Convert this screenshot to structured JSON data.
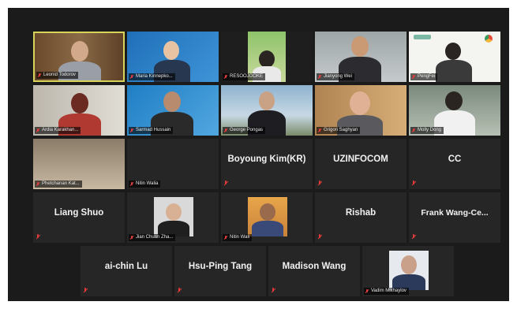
{
  "meeting": {
    "participants": [
      {
        "name": "Leonid Todorov",
        "style": "video",
        "active": true
      },
      {
        "name": "Maria Kinnepko...",
        "style": "video"
      },
      {
        "name": "RESOOJOOKE",
        "style": "video"
      },
      {
        "name": "Jianyong Wei",
        "style": "video"
      },
      {
        "name": "PengFei",
        "style": "video"
      },
      {
        "name": "Ardia Karakhan...",
        "style": "video"
      },
      {
        "name": "Sarmad Hussain",
        "style": "video"
      },
      {
        "name": "George Pongas",
        "style": "video"
      },
      {
        "name": "Grigori Saghyan",
        "style": "video"
      },
      {
        "name": "Molly Dong",
        "style": "video"
      },
      {
        "name": "Phetchanan Kat...",
        "style": "video"
      },
      {
        "name": "Nitin Walia",
        "style": "video"
      },
      {
        "name": "Boyoung Kim(KR)",
        "style": "name"
      },
      {
        "name": "UZINFOCOM",
        "style": "name"
      },
      {
        "name": "CC",
        "style": "name"
      },
      {
        "name": "Liang Shuo",
        "style": "name"
      },
      {
        "name": "Jian Chuan Zha...",
        "style": "photo"
      },
      {
        "name": "Nitin Wali",
        "style": "photo"
      },
      {
        "name": "Rishab",
        "style": "name"
      },
      {
        "name": "Frank Wang-Ce...",
        "style": "name"
      },
      {
        "name": "ai-chin Lu",
        "style": "name"
      },
      {
        "name": "Hsu-Ping Tang",
        "style": "name"
      },
      {
        "name": "Madison Wang",
        "style": "name"
      },
      {
        "name": "Vadim Mikhaylov",
        "style": "photo"
      }
    ]
  }
}
